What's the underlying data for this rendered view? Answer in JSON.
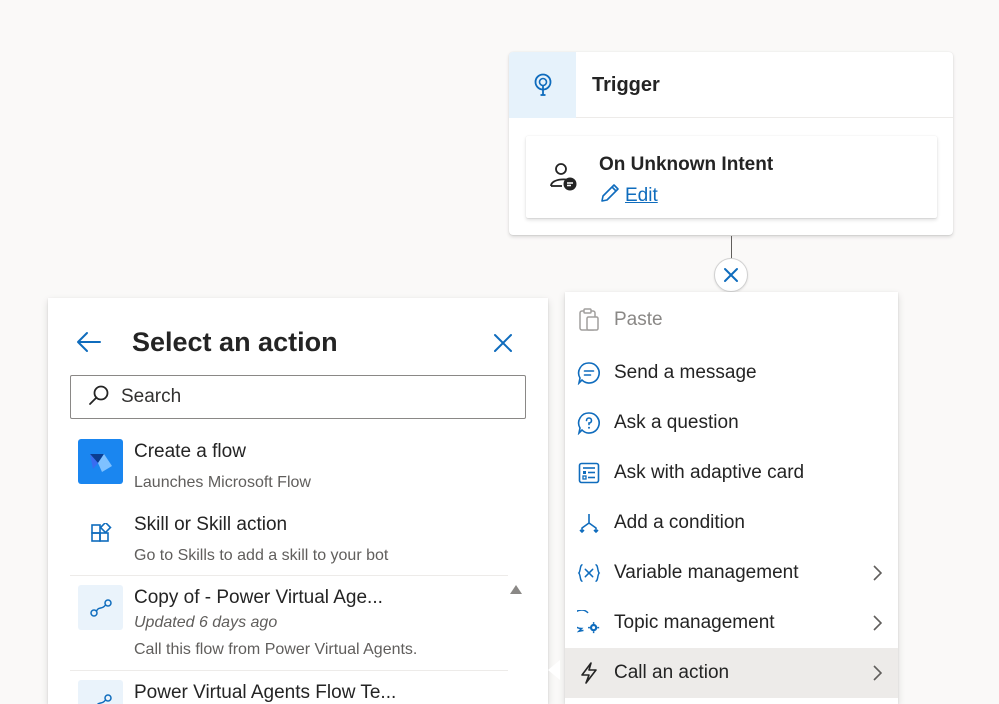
{
  "trigger": {
    "title": "Trigger",
    "icon": "lightbulb-icon",
    "intent_title": "On Unknown Intent",
    "intent_icon": "person-chat-icon",
    "edit_label": "Edit"
  },
  "connector": {
    "icon": "close-icon"
  },
  "action_panel": {
    "title": "Select an action",
    "search_placeholder": "Search",
    "items": [
      {
        "title": "Create a flow",
        "subtitle": "Launches Microsoft Flow",
        "icon": "power-automate-icon"
      },
      {
        "title": "Skill or Skill action",
        "subtitle": "Go to Skills to add a skill to your bot",
        "icon": "apps-add-icon"
      },
      {
        "title": "Copy of - Power Virtual Age...",
        "updated": "Updated 6 days ago",
        "subtitle": "Call this flow from Power Virtual Agents.",
        "icon": "flow-icon"
      },
      {
        "title": "Power Virtual Agents Flow Te...",
        "icon": "flow-icon"
      }
    ]
  },
  "menu": {
    "items": [
      {
        "label": "Paste",
        "icon": "clipboard-icon",
        "disabled": true
      },
      {
        "label": "Send a message",
        "icon": "chat-message-icon"
      },
      {
        "label": "Ask a question",
        "icon": "question-bubble-icon"
      },
      {
        "label": "Ask with adaptive card",
        "icon": "adaptive-card-icon"
      },
      {
        "label": "Add a condition",
        "icon": "branch-icon"
      },
      {
        "label": "Variable management",
        "icon": "variable-icon",
        "submenu": true
      },
      {
        "label": "Topic management",
        "icon": "topic-settings-icon",
        "submenu": true
      },
      {
        "label": "Call an action",
        "icon": "lightning-icon",
        "submenu": true,
        "active": true
      }
    ]
  },
  "colors": {
    "accent": "#0f6cbd",
    "trigger_icon_bg": "#e6f2fb",
    "active_menu_bg": "#edebe9",
    "flow_tile": "#1a86f0"
  }
}
